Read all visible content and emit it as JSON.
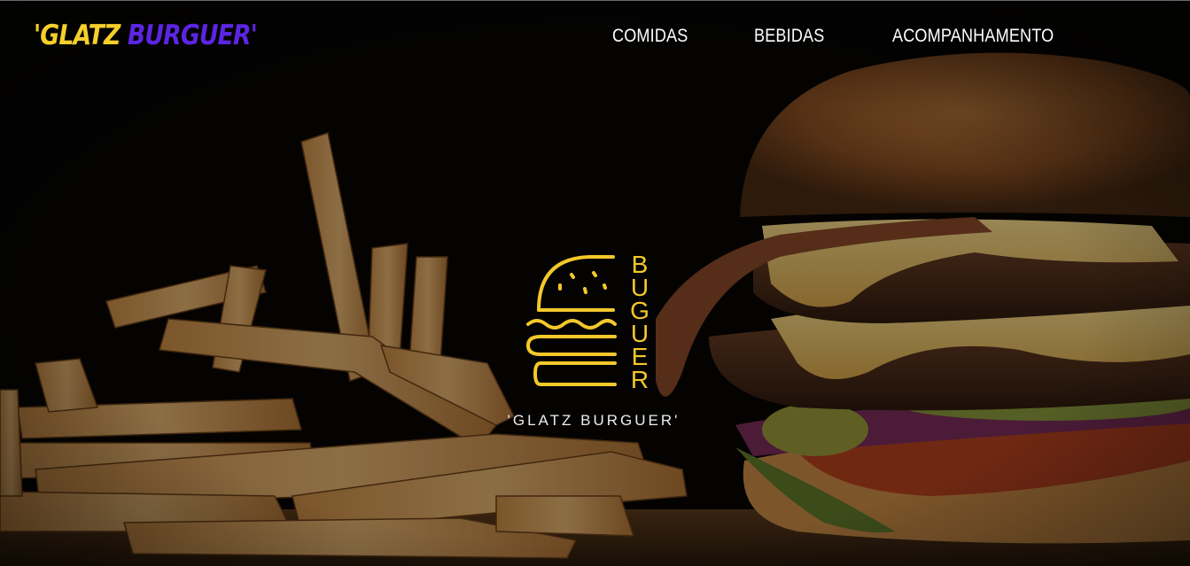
{
  "header": {
    "brand_part1": "'GLATZ ",
    "brand_part2": "BURGUER'",
    "brand_color1": "#f5cf2b",
    "brand_color2": "#5b25e2"
  },
  "nav": {
    "items": [
      {
        "label": "COMIDAS"
      },
      {
        "label": "BEBIDAS"
      },
      {
        "label": "ACOMPANHAMENTO"
      }
    ]
  },
  "hero": {
    "logo_text": "BUGUER",
    "logo_caption": "'GLATZ BURGUER'",
    "logo_color": "#f3c82a",
    "image_subject": "burger-and-fries-photo"
  }
}
